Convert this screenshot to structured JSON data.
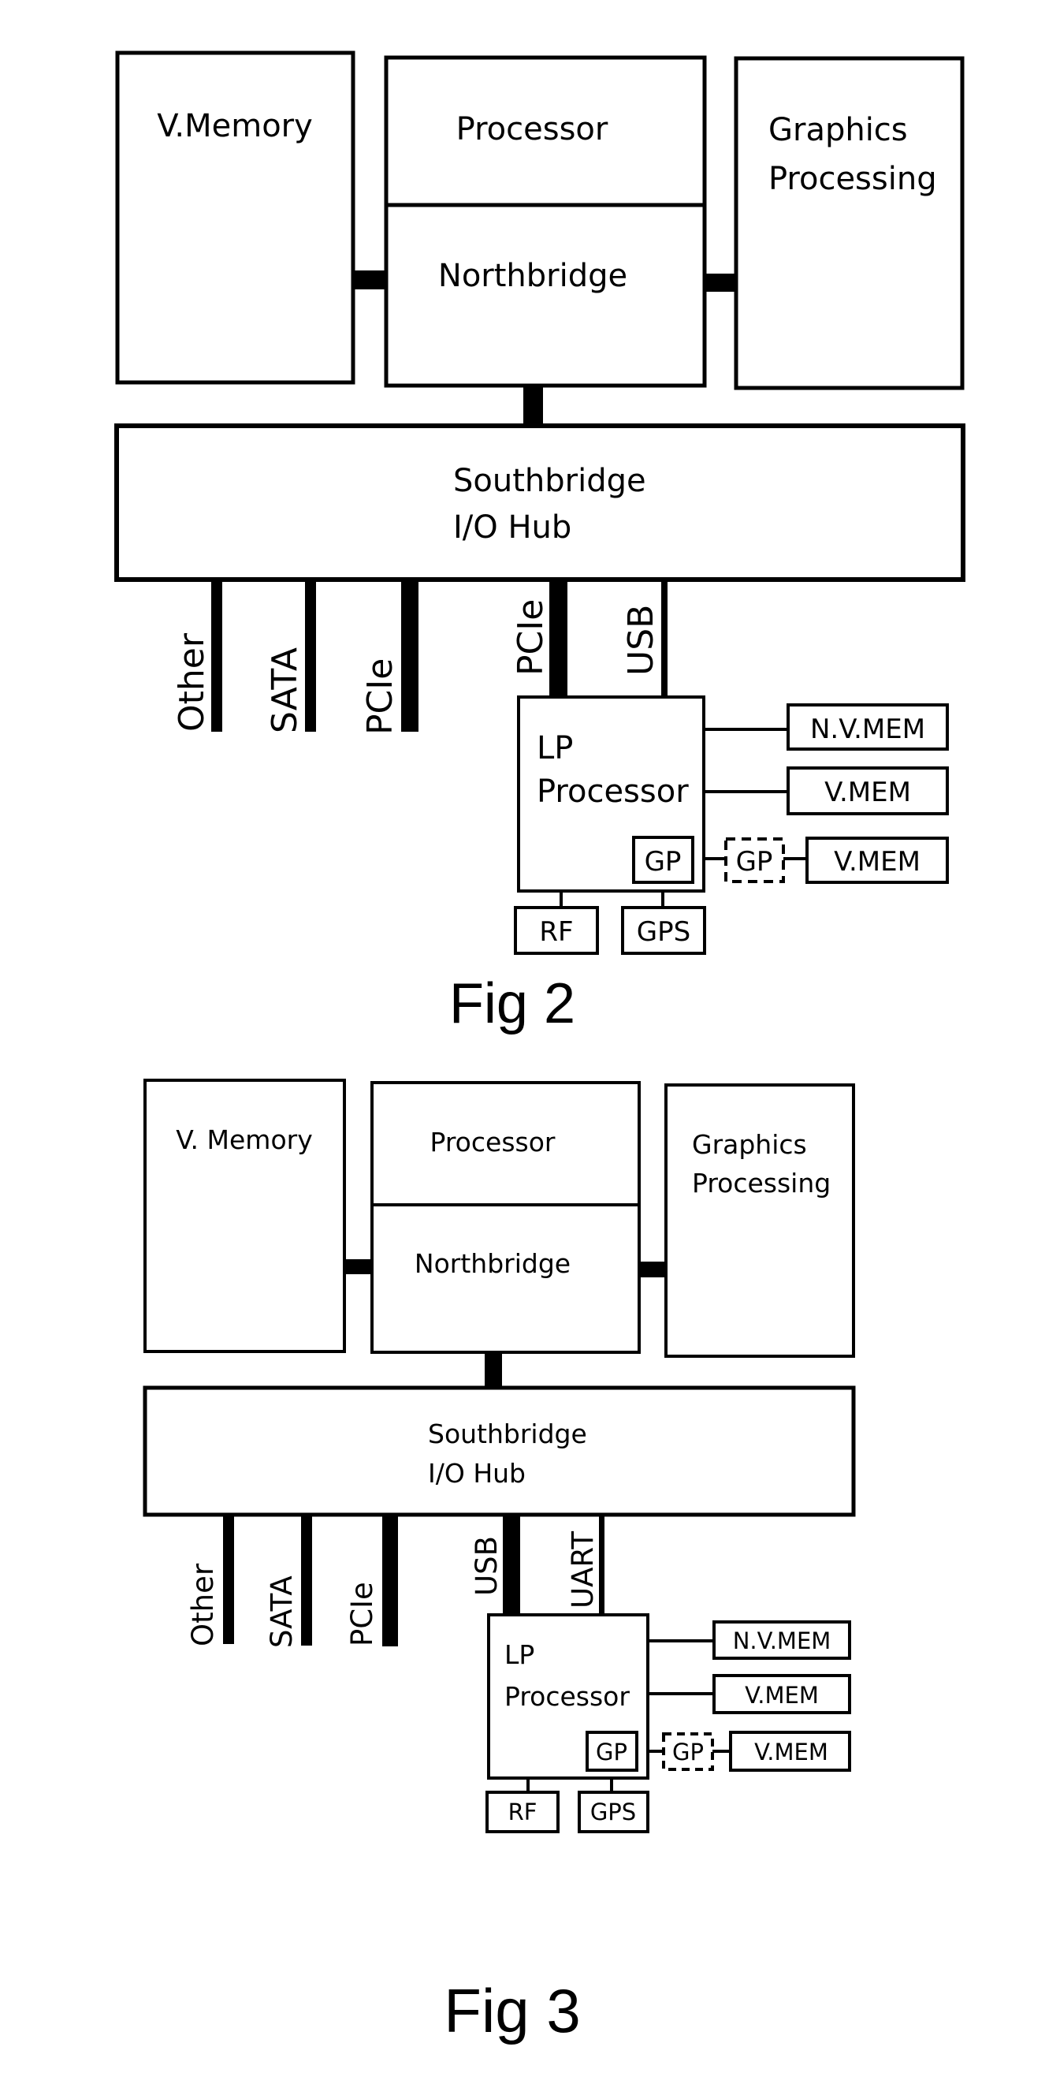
{
  "figures": [
    {
      "caption": "Fig 2",
      "blocks": {
        "v_memory": "V.Memory",
        "processor": "Processor",
        "northbridge": "Northbridge",
        "graphics_line1": "Graphics",
        "graphics_line2": "Processing",
        "southbridge_line1": "Southbridge",
        "southbridge_line2": "I/O Hub",
        "lp_line1": "LP",
        "lp_line2": "Processor",
        "gp_internal": "GP",
        "gp_external": "GP",
        "nv_mem": "N.V.MEM",
        "v_mem": "V.MEM",
        "gp_v_mem": "V.MEM",
        "rf": "RF",
        "gps": "GPS"
      },
      "buses": [
        "Other",
        "SATA",
        "PCIe",
        "PCIe",
        "USB"
      ]
    },
    {
      "caption": "Fig 3",
      "blocks": {
        "v_memory": "V. Memory",
        "processor": "Processor",
        "northbridge": "Northbridge",
        "graphics_line1": "Graphics",
        "graphics_line2": "Processing",
        "southbridge_line1": "Southbridge",
        "southbridge_line2": "I/O Hub",
        "lp_line1": "LP",
        "lp_line2": "Processor",
        "gp_internal": "GP",
        "gp_external": "GP",
        "nv_mem": "N.V.MEM",
        "v_mem": "V.MEM",
        "gp_v_mem": "V.MEM",
        "rf": "RF",
        "gps": "GPS"
      },
      "buses": [
        "Other",
        "SATA",
        "PCIe",
        "USB",
        "UART"
      ]
    }
  ]
}
